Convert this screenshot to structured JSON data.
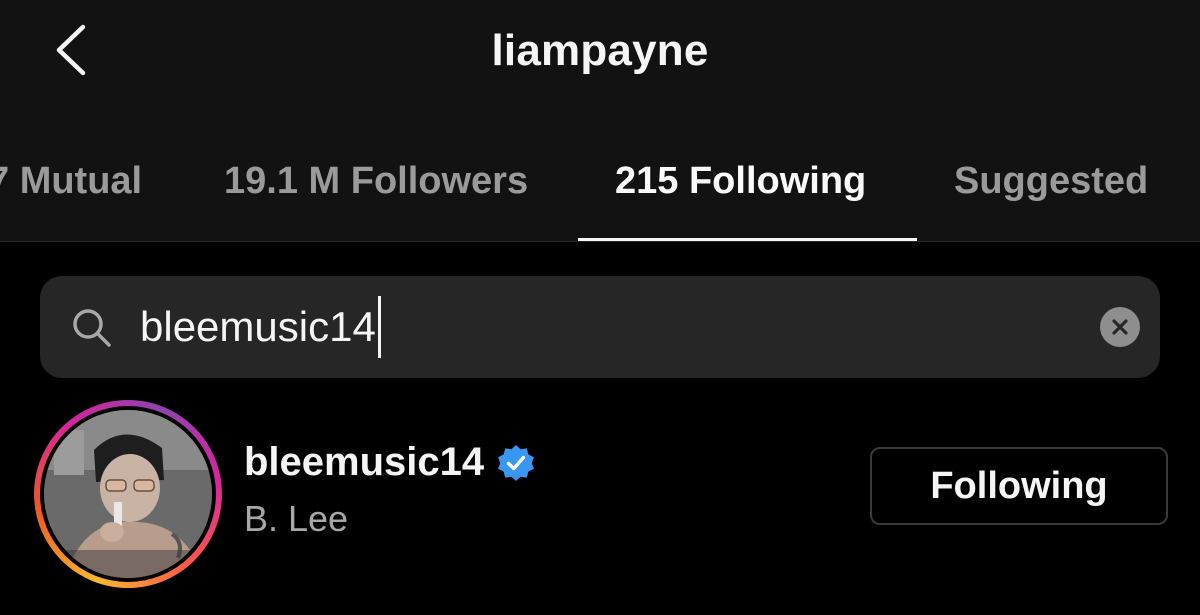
{
  "header": {
    "title": "liampayne",
    "back_icon": "chevron-left-icon"
  },
  "tabs": [
    {
      "label": "7 Mutual",
      "active": false
    },
    {
      "label": "19.1 M Followers",
      "active": false
    },
    {
      "label": "215 Following",
      "active": true
    },
    {
      "label": "Suggested",
      "active": false
    }
  ],
  "search": {
    "value": "bleemusic14",
    "icon": "search-icon",
    "clear_icon": "clear-icon"
  },
  "result": {
    "username": "bleemusic14",
    "verified": true,
    "full_name": "B. Lee",
    "button_label": "Following"
  },
  "colors": {
    "background": "#000000",
    "header": "#121212",
    "search_bg": "#262626",
    "verified_badge": "#3897f0",
    "inactive_tab": "#9a9a9a"
  }
}
